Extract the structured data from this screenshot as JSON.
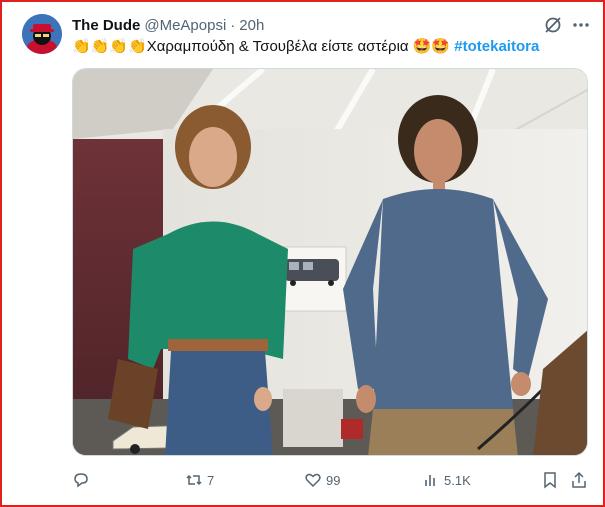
{
  "tweet": {
    "author_name": "The Dude",
    "handle": "@MeApopsi",
    "separator": "·",
    "time": "20h",
    "text_prefix": "👏👏👏👏",
    "text_body": "Χαραμπούδη & Τσουβέλα είστε αστέρια ",
    "text_emojis": "🤩🤩",
    "hashtag": "#totekaitora"
  },
  "actions": {
    "replies": "",
    "retweets": "7",
    "likes": "99",
    "views": "5.1K"
  },
  "icons": [
    "avatar",
    "grok-icon",
    "more-icon",
    "reply-icon",
    "retweet-icon",
    "like-icon",
    "views-icon",
    "bookmark-icon",
    "share-icon"
  ],
  "colors": {
    "accent": "#1d9bf0",
    "text": "#0f1419",
    "muted": "#536471",
    "frame": "#e0201e"
  }
}
